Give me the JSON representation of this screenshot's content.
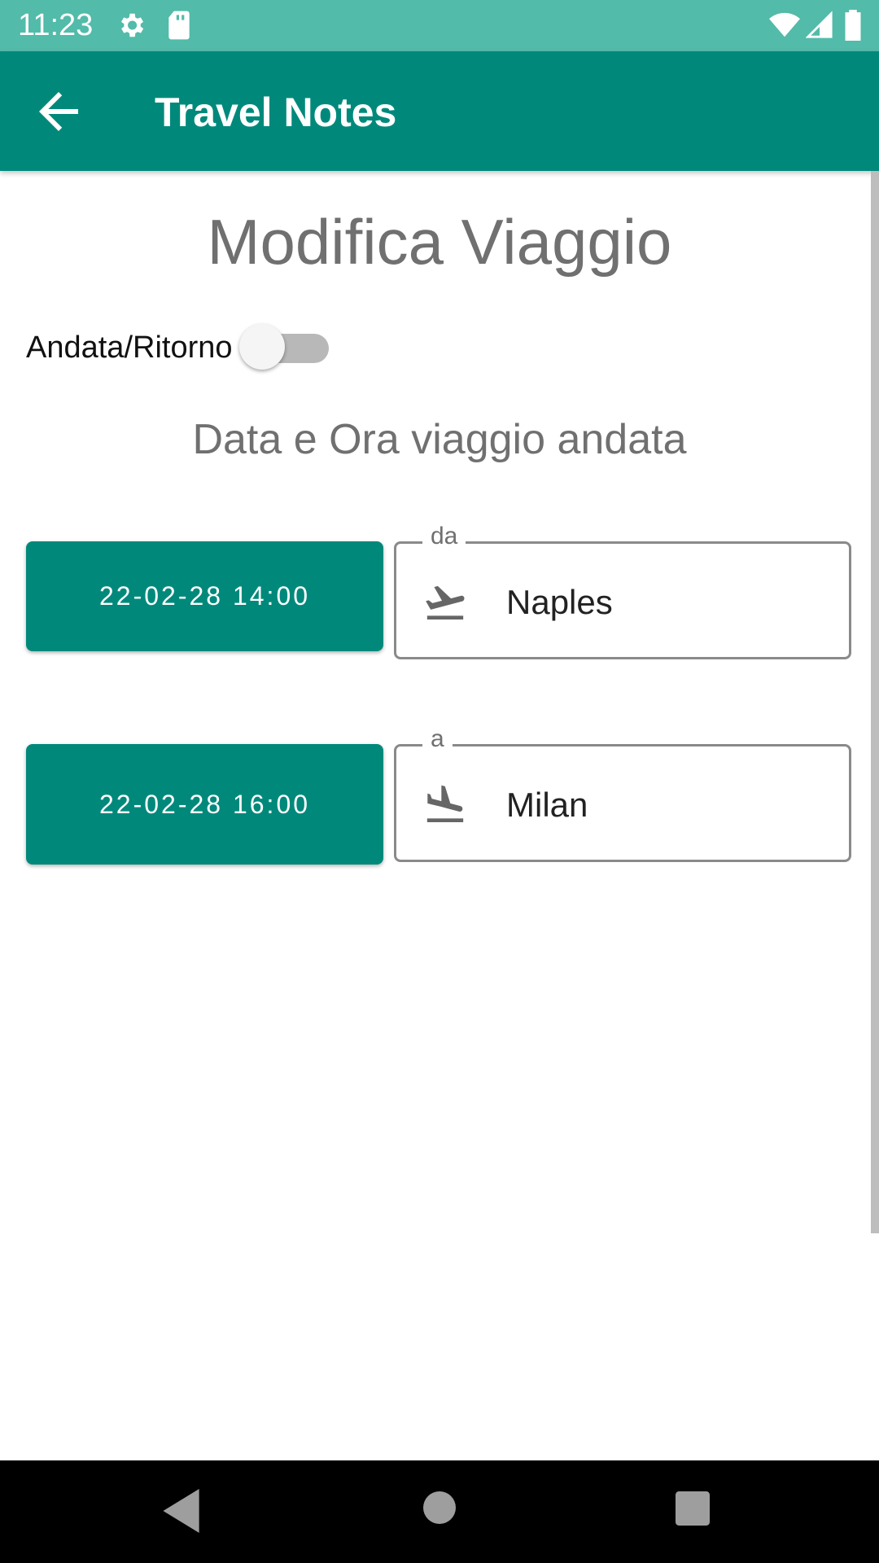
{
  "status_bar": {
    "time": "11:23",
    "icons": [
      "settings-icon",
      "sd-card-icon",
      "wifi-icon",
      "signal-icon",
      "battery-icon"
    ]
  },
  "app_bar": {
    "back_icon": "arrow-back-icon",
    "title": "Travel Notes",
    "color": "#00897b"
  },
  "main": {
    "heading": "Modifica Viaggio",
    "round_trip": {
      "label": "Andata/Ritorno",
      "on": false
    },
    "subheading": "Data e Ora viaggio andata",
    "departure": {
      "datetime": "22-02-28 14:00",
      "field_label": "da",
      "field_icon": "flight-takeoff-icon",
      "value": "Naples"
    },
    "arrival": {
      "datetime": "22-02-28 16:00",
      "field_label": "a",
      "field_icon": "flight-land-icon",
      "value": "Milan"
    }
  },
  "nav_bar": {
    "icons": [
      "nav-back-icon",
      "nav-home-icon",
      "nav-recents-icon"
    ]
  }
}
